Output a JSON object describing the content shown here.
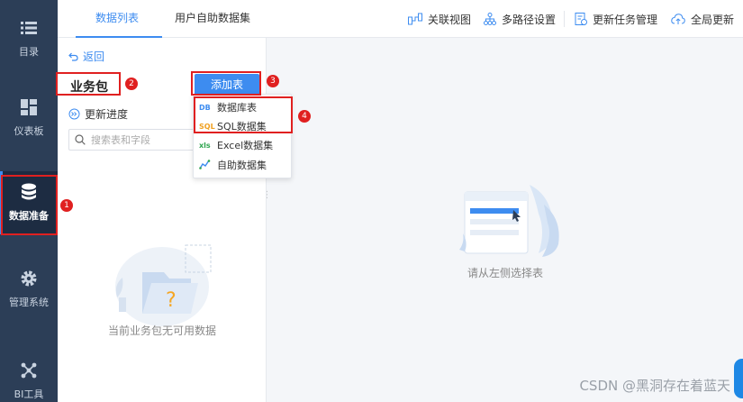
{
  "rail": {
    "items": [
      {
        "label": "目录",
        "icon": "list-icon"
      },
      {
        "label": "仪表板",
        "icon": "dashboard-icon"
      },
      {
        "label": "数据准备",
        "icon": "database-icon",
        "active": true
      },
      {
        "label": "管理系统",
        "icon": "gear-icon"
      },
      {
        "label": "BI工具",
        "icon": "bi-tools-icon"
      }
    ]
  },
  "tabs": [
    {
      "label": "数据列表",
      "active": true
    },
    {
      "label": "用户自助数据集",
      "active": false
    }
  ],
  "toolbar": {
    "related_view": "关联视图",
    "multi_path": "多路径设置",
    "update_task": "更新任务管理",
    "global_update": "全局更新"
  },
  "panel": {
    "back": "返回",
    "title": "业务包",
    "add_table": "添加表",
    "update_progress": "更新进度",
    "search_placeholder": "搜索表和字段",
    "empty_text": "当前业务包无可用数据"
  },
  "dropdown": {
    "items": [
      {
        "label": "数据库表",
        "icon": "DB"
      },
      {
        "label": "SQL数据集",
        "icon": "SQL"
      },
      {
        "label": "Excel数据集",
        "icon": "xls"
      },
      {
        "label": "自助数据集",
        "icon": "self-service-icon"
      }
    ]
  },
  "main": {
    "empty_text": "请从左侧选择表"
  },
  "annotations": {
    "b1": "1",
    "b2": "2",
    "b3": "3",
    "b4": "4"
  },
  "watermark": "CSDN @黑洞存在着蓝天",
  "colors": {
    "accent": "#3d8cf0",
    "rail": "#2c3e57",
    "annotation": "#e02020"
  }
}
